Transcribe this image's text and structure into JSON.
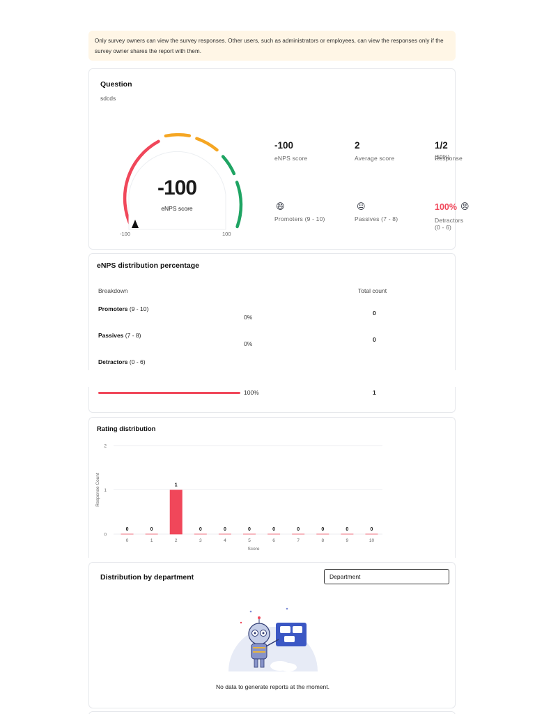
{
  "notice": {
    "text": "Only survey owners can view the survey responses. Other users, such as administrators or employees, can view the responses only if the survey owner shares the report with them."
  },
  "question": {
    "title": "Question",
    "text": "sdcds",
    "gauge": {
      "value": "-100",
      "label": "eNPS score",
      "min_label": "-100",
      "max_label": "100",
      "value_numeric": -100,
      "min": -100,
      "max": 100
    },
    "stats": [
      {
        "value": "-100",
        "label": "eNPS score"
      },
      {
        "value": "2",
        "label": "Average score"
      },
      {
        "value": "1/2",
        "suffix": "(50%)",
        "label": "Response"
      }
    ],
    "groups": [
      {
        "percent": "",
        "emoji_icon": "grinning-face-icon",
        "label": "Promoters (9 - 10)"
      },
      {
        "percent": "",
        "emoji_icon": "neutral-face-icon",
        "label": "Passives (7 - 8)"
      },
      {
        "percent": "100%",
        "emoji_icon": "angry-face-icon",
        "label": "Detractors (0 - 6)"
      }
    ]
  },
  "enps_distribution": {
    "title": "eNPS distribution percentage",
    "col_breakdown": "Breakdown",
    "col_total": "Total count",
    "rows": [
      {
        "name": "Promoters",
        "range": "(9 - 10)",
        "percent": "0%",
        "count": "0",
        "fill": 0
      },
      {
        "name": "Passives",
        "range": "(7 - 8)",
        "percent": "0%",
        "count": "0",
        "fill": 0
      },
      {
        "name": "Detractors",
        "range": "(0 - 6)",
        "percent": "100%",
        "count": "1",
        "fill": 1.0
      }
    ]
  },
  "rating": {
    "title": "Rating distribution",
    "chart_data": {
      "type": "bar",
      "categories": [
        "0",
        "1",
        "2",
        "3",
        "4",
        "5",
        "6",
        "7",
        "8",
        "9",
        "10"
      ],
      "values": [
        0,
        0,
        1,
        0,
        0,
        0,
        0,
        0,
        0,
        0,
        0
      ],
      "xlabel": "Score",
      "ylabel": "Response Count",
      "ylim": [
        0,
        2
      ],
      "yticks": [
        0,
        1,
        2
      ],
      "bar_color": "#f0475a",
      "grid": true
    }
  },
  "department": {
    "title": "Distribution by department",
    "dropdown_value": "Department",
    "empty_message": "No data to generate reports at the moment."
  },
  "colors": {
    "accent_red": "#f0475a",
    "gauge_orange": "#f5a623",
    "gauge_green": "#1fa463",
    "notice_bg": "#fff6e6"
  }
}
